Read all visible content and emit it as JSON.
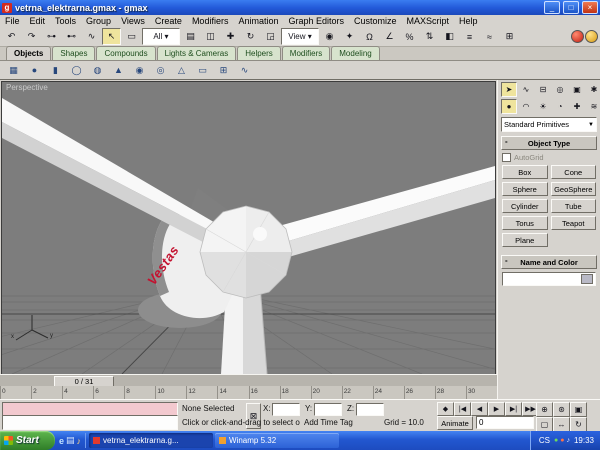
{
  "window": {
    "title": "vetrna_elektrarna.gmax - gmax",
    "icon_letter": "g",
    "minimize_glyph": "_",
    "maximize_glyph": "□",
    "close_glyph": "×"
  },
  "menubar": {
    "items": [
      "File",
      "Edit",
      "Tools",
      "Group",
      "Views",
      "Create",
      "Modifiers",
      "Animation",
      "Graph Editors",
      "Customize",
      "MAXScript",
      "Help"
    ]
  },
  "toolbar_main": {
    "icons": [
      {
        "name": "undo-icon",
        "glyph": "↶"
      },
      {
        "name": "redo-icon",
        "glyph": "↷"
      },
      {
        "name": "select-and-link-icon",
        "glyph": "⊶"
      },
      {
        "name": "unlink-selection-icon",
        "glyph": "⊷"
      },
      {
        "name": "bind-to-space-warp-icon",
        "glyph": "∿"
      },
      {
        "name": "select-object-icon",
        "glyph": "↖",
        "state": "pressed"
      },
      {
        "name": "rectangular-selection-region-icon",
        "glyph": "▭"
      },
      {
        "name": "selection-filter-dropdown",
        "glyph": "All ▾",
        "state": "dropdown"
      },
      {
        "name": "select-by-name-icon",
        "glyph": "▤"
      },
      {
        "name": "window-crossing-toggle-icon",
        "glyph": "◫"
      },
      {
        "name": "select-and-move-icon",
        "glyph": "✚"
      },
      {
        "name": "select-and-rotate-icon",
        "glyph": "↻"
      },
      {
        "name": "select-and-scale-icon",
        "glyph": "◲"
      },
      {
        "name": "reference-coordinate-dropdown",
        "glyph": "View ▾",
        "state": "dropdown"
      },
      {
        "name": "use-pivot-point-icon",
        "glyph": "◉"
      },
      {
        "name": "select-and-manipulate-icon",
        "glyph": "✦"
      },
      {
        "name": "snap-toggle-icon",
        "glyph": "Ω"
      },
      {
        "name": "angle-snap-icon",
        "glyph": "∠"
      },
      {
        "name": "percent-snap-icon",
        "glyph": "%"
      },
      {
        "name": "spinner-snap-icon",
        "glyph": "⇅"
      },
      {
        "name": "mirror-icon",
        "glyph": "◧"
      },
      {
        "name": "align-icon",
        "glyph": "≡"
      },
      {
        "name": "curve-editor-icon",
        "glyph": "≈"
      },
      {
        "name": "schematic-view-icon",
        "glyph": "⊞"
      }
    ]
  },
  "tab_panel": {
    "tabs": [
      {
        "name": "tab-objects",
        "label": "Objects",
        "state": "active"
      },
      {
        "name": "tab-shapes",
        "label": "Shapes"
      },
      {
        "name": "tab-compounds",
        "label": "Compounds"
      },
      {
        "name": "tab-lights-cameras",
        "label": "Lights & Cameras"
      },
      {
        "name": "tab-helpers",
        "label": "Helpers"
      },
      {
        "name": "tab-modifiers",
        "label": "Modifiers"
      },
      {
        "name": "tab-modeling",
        "label": "Modeling"
      }
    ]
  },
  "toolbar_objects": {
    "icons": [
      {
        "name": "box-tool-icon",
        "glyph": "▦"
      },
      {
        "name": "sphere-tool-icon",
        "glyph": "●"
      },
      {
        "name": "cylinder-tool-icon",
        "glyph": "▮"
      },
      {
        "name": "torus-tool-icon",
        "glyph": "◯"
      },
      {
        "name": "teapot-tool-icon",
        "glyph": "◍"
      },
      {
        "name": "cone-tool-icon",
        "glyph": "▲"
      },
      {
        "name": "geosphere-tool-icon",
        "glyph": "◉"
      },
      {
        "name": "tube-tool-icon",
        "glyph": "◎"
      },
      {
        "name": "pyramid-tool-icon",
        "glyph": "△"
      },
      {
        "name": "plane-tool-icon",
        "glyph": "▭"
      },
      {
        "name": "quad-patch-tool-icon",
        "glyph": "⊞"
      },
      {
        "name": "spline-tool-icon",
        "glyph": "∿"
      }
    ]
  },
  "viewport": {
    "label": "Perspective",
    "hub_logo": "Vestas",
    "axis_x_label": "x",
    "axis_y_label": "y"
  },
  "command_panel": {
    "tabs": [
      {
        "name": "create-tab-icon",
        "glyph": "➤",
        "state": "pressed"
      },
      {
        "name": "modify-tab-icon",
        "glyph": "∿"
      },
      {
        "name": "hierarchy-tab-icon",
        "glyph": "⊟"
      },
      {
        "name": "motion-tab-icon",
        "glyph": "◎"
      },
      {
        "name": "display-tab-icon",
        "glyph": "▣"
      },
      {
        "name": "utilities-tab-icon",
        "glyph": "✱"
      }
    ],
    "categories": [
      {
        "name": "geometry-category-icon",
        "glyph": "●",
        "state": "pressed"
      },
      {
        "name": "shapes-category-icon",
        "glyph": "◠"
      },
      {
        "name": "lights-category-icon",
        "glyph": "☀"
      },
      {
        "name": "cameras-category-icon",
        "glyph": "◔"
      },
      {
        "name": "helpers-category-icon",
        "glyph": "✚"
      },
      {
        "name": "spacewarps-category-icon",
        "glyph": "≋"
      },
      {
        "name": "systems-category-icon",
        "glyph": "⚙"
      }
    ],
    "primitives_dropdown": "Standard Primitives",
    "dropdown_arrow": "▼",
    "object_type": {
      "title": "Object Type",
      "autogrid_label": "AutoGrid",
      "buttons": [
        "Box",
        "Cone",
        "Sphere",
        "GeoSphere",
        "Cylinder",
        "Tube",
        "Torus",
        "Teapot",
        "Plane"
      ]
    },
    "name_color": {
      "title": "Name and Color"
    }
  },
  "timeline": {
    "slider_label": "0 / 31",
    "ticks": [
      "0",
      "2",
      "4",
      "6",
      "8",
      "10",
      "12",
      "14",
      "16",
      "18",
      "20",
      "22",
      "24",
      "26",
      "28",
      "30"
    ]
  },
  "status_bar": {
    "selection_status": "None Selected",
    "lock_glyph": "⊠",
    "coords": {
      "x_label": "X:",
      "y_label": "Y:",
      "z_label": "Z:",
      "x_value": "",
      "y_value": "",
      "z_value": "",
      "spinner": "⇅"
    },
    "grid_label": "Grid = 10.0",
    "prompt": "Click or click-and-drag to select objects",
    "time_tag": "Add Time Tag",
    "animate_label": "Animate",
    "frame_value": "0",
    "playback": [
      {
        "name": "key-mode-toggle-button",
        "glyph": "◆"
      },
      {
        "name": "go-to-start-button",
        "glyph": "|◀"
      },
      {
        "name": "previous-frame-button",
        "glyph": "◀"
      },
      {
        "name": "play-animation-button",
        "glyph": "▶"
      },
      {
        "name": "next-frame-button",
        "glyph": "▶|"
      },
      {
        "name": "go-to-end-button",
        "glyph": "▶▶"
      }
    ],
    "nav": [
      {
        "name": "zoom-button",
        "glyph": "⊕"
      },
      {
        "name": "zoom-all-button",
        "glyph": "⊛"
      },
      {
        "name": "zoom-extents-button",
        "glyph": "▣"
      },
      {
        "name": "zoom-extents-all-button",
        "glyph": "▢"
      },
      {
        "name": "pan-button",
        "glyph": "↔"
      },
      {
        "name": "arc-rotate-button",
        "glyph": "↻"
      },
      {
        "name": "zoom-region-button",
        "glyph": "◱"
      },
      {
        "name": "min-max-toggle-button",
        "glyph": "⊞"
      }
    ]
  },
  "taskbar": {
    "start_label": "Start",
    "quick_launch": [
      {
        "name": "internet-explorer-icon",
        "glyph": "e",
        "color": "#bfe0ff"
      },
      {
        "name": "show-desktop-icon",
        "glyph": "▤",
        "color": "#d8e8ff"
      },
      {
        "name": "media-player-icon",
        "glyph": "♪",
        "color": "#ffd27a"
      }
    ],
    "tasks": [
      {
        "name": "task-gmax",
        "label": "vetrna_elektrarna.g...",
        "state": "active",
        "icon_color": "#e23a2e"
      },
      {
        "name": "task-winamp",
        "label": "Winamp 5.32",
        "icon_color": "#f0a030"
      }
    ],
    "tray": {
      "lang": "CS",
      "icons": [
        {
          "name": "tray-status-icon-green",
          "glyph": "●",
          "color": "#6cd95c"
        },
        {
          "name": "tray-winamp-icon",
          "glyph": "●",
          "color": "#ff7043"
        },
        {
          "name": "tray-volume-icon",
          "glyph": "♪",
          "color": "#e8f0ff"
        }
      ],
      "clock": "19:33"
    }
  }
}
